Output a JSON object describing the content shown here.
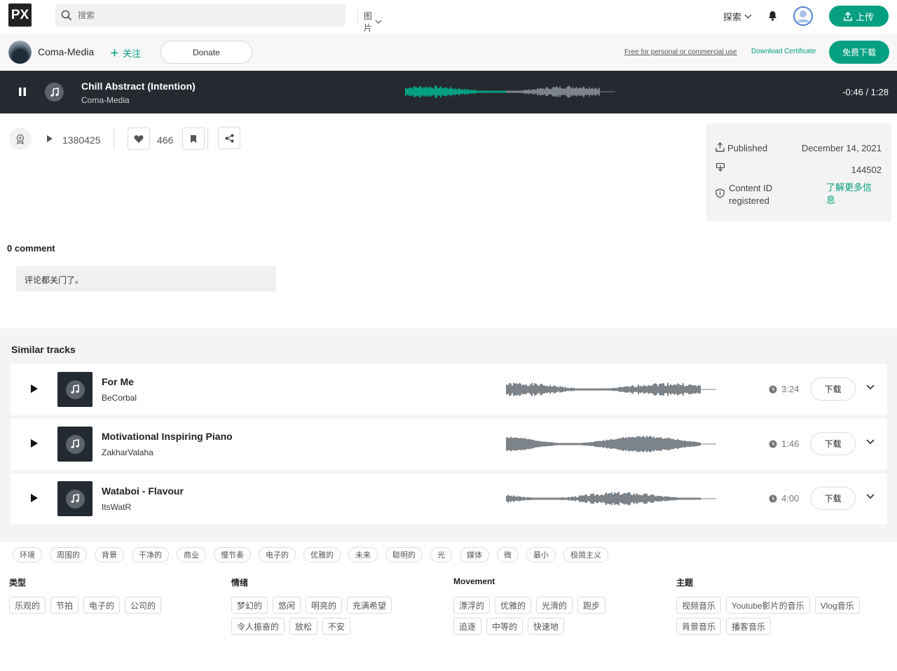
{
  "nav": {
    "logo": "PX",
    "search_placeholder": "搜索",
    "search_type": "图片",
    "explore": "探索",
    "upload": "上传"
  },
  "author": {
    "name": "Coma-Media",
    "follow": "关注",
    "donate": "Donate",
    "free_use": "Free for personal or commercial use",
    "download_certificate": "Download Certificate",
    "free_download": "免费下载"
  },
  "player": {
    "title": "Chill Abstract (Intention)",
    "artist": "Coma-Media",
    "time": "-0:46 / 1:28",
    "progress": 0.48
  },
  "stats": {
    "plays": "1380425",
    "likes": "466"
  },
  "info": {
    "published_label": "Published",
    "published_value": "December 14, 2021",
    "downloads_value": "144502",
    "content_id_label": "Content ID registered",
    "learn_more": "了解更多信息"
  },
  "comments": {
    "title": "0 comment",
    "closed": "评论都关门了。"
  },
  "similar": {
    "title": "Similar tracks",
    "download_label": "下载",
    "tracks": [
      {
        "title": "For Me",
        "artist": "BeCorbal",
        "duration": "3:24"
      },
      {
        "title": "Motivational Inspiring Piano",
        "artist": "ZakharValaha",
        "duration": "1:46"
      },
      {
        "title": "Wataboi - Flavour",
        "artist": "ItsWatR",
        "duration": "4:00"
      }
    ]
  },
  "tags": [
    "环境",
    "周围的",
    "背景",
    "干净的",
    "商业",
    "慢节奏",
    "电子的",
    "优雅的",
    "未来",
    "聪明的",
    "光",
    "媒体",
    "微",
    "最小",
    "极简主义"
  ],
  "categories": [
    {
      "title": "类型",
      "items": [
        "乐观的",
        "节拍",
        "电子的",
        "公司的"
      ]
    },
    {
      "title": "情绪",
      "items": [
        "梦幻的",
        "悠闲",
        "明亮的",
        "充满希望",
        "令人振奋的",
        "放松",
        "不安"
      ]
    },
    {
      "title": "Movement",
      "items": [
        "漂浮的",
        "优雅的",
        "光滑的",
        "跑步",
        "追逐",
        "中等的",
        "快速地"
      ]
    },
    {
      "title": "主题",
      "items": [
        "视频音乐",
        "Youtube影片的音乐",
        "Vlog音乐",
        "背景音乐",
        "播客音乐"
      ]
    }
  ],
  "colors": {
    "accent": "#05a081",
    "player_bg": "#252a30",
    "wave_gray": "#7c8389"
  }
}
